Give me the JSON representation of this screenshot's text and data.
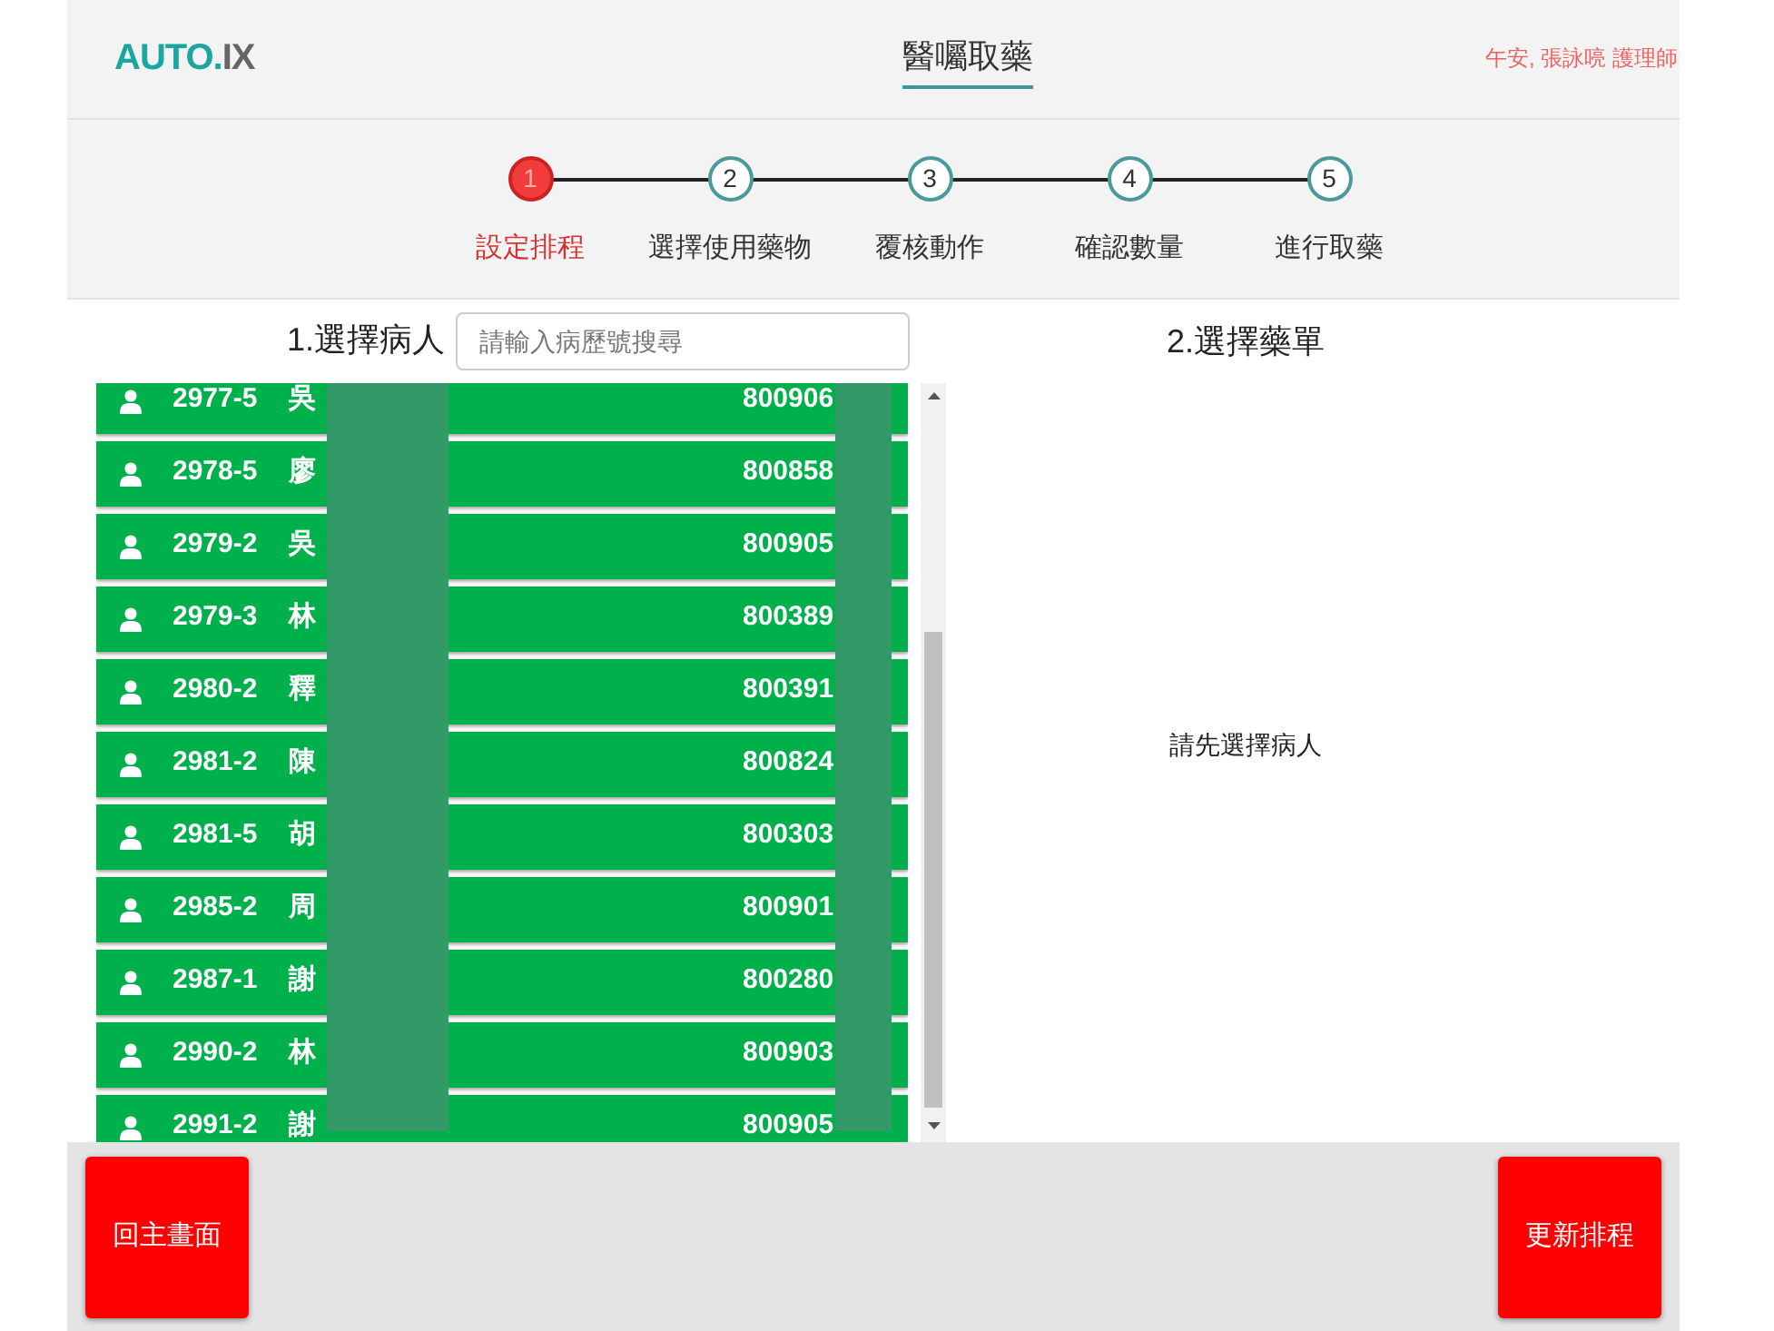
{
  "header": {
    "logo": {
      "main": "AUTO.",
      "suffix": "IX"
    },
    "title": "醫囑取藥",
    "greeting": "午安, 張詠喨 護理師"
  },
  "steps": [
    {
      "number": "1",
      "label": "設定排程",
      "selected": true
    },
    {
      "number": "2",
      "label": "選擇使用藥物",
      "selected": false
    },
    {
      "number": "3",
      "label": "覆核動作",
      "selected": false
    },
    {
      "number": "4",
      "label": "確認數量",
      "selected": false
    },
    {
      "number": "5",
      "label": "進行取藥",
      "selected": false
    }
  ],
  "patient_panel": {
    "heading": "1.選擇病人",
    "search": {
      "placeholder": "請輸入病歷號搜尋"
    },
    "patients": [
      {
        "bed": "2977-5",
        "name": "吳",
        "number": "800906"
      },
      {
        "bed": "2978-5",
        "name": "廖",
        "number": "800858"
      },
      {
        "bed": "2979-2",
        "name": "吳",
        "number": "800905"
      },
      {
        "bed": "2979-3",
        "name": "林",
        "number": "800389"
      },
      {
        "bed": "2980-2",
        "name": "釋",
        "number": "800391"
      },
      {
        "bed": "2981-2",
        "name": "陳",
        "number": "800824"
      },
      {
        "bed": "2981-5",
        "name": "胡",
        "number": "800303"
      },
      {
        "bed": "2985-2",
        "name": "周",
        "number": "800901"
      },
      {
        "bed": "2987-1",
        "name": "謝",
        "number": "800280"
      },
      {
        "bed": "2990-2",
        "name": "林",
        "number": "800903"
      },
      {
        "bed": "2991-2",
        "name": "謝",
        "number": "800905"
      }
    ]
  },
  "order_panel": {
    "heading": "2.選擇藥單",
    "empty_message": "請先選擇病人"
  },
  "footer": {
    "buttons": [
      {
        "label": "回主畫面"
      },
      {
        "label": "更新排程"
      }
    ]
  }
}
